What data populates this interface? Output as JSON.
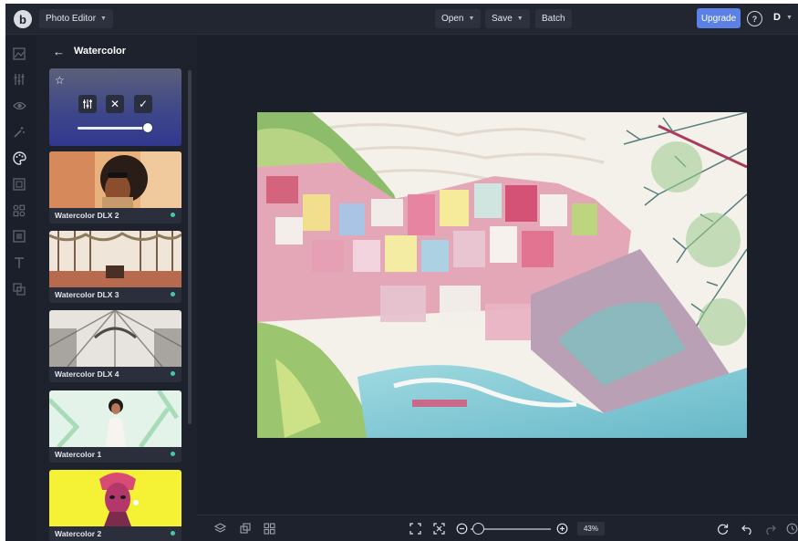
{
  "topbar": {
    "app_menu_label": "Photo Editor",
    "open_label": "Open",
    "save_label": "Save",
    "batch_label": "Batch",
    "upgrade_label": "Upgrade",
    "help_glyph": "?",
    "user_initial": "D",
    "logo_letter": "b"
  },
  "rail": {
    "icons": [
      "image-icon",
      "adjust-icon",
      "eye-icon",
      "magic-wand-icon",
      "palette-icon",
      "frame-icon",
      "graphics-icon",
      "texture-icon",
      "text-icon",
      "layers-icon"
    ],
    "active": "palette-icon"
  },
  "panel": {
    "title": "Watercolor",
    "settings": {
      "favorite_icon": "star-icon",
      "adjust_icon": "sliders-icon",
      "cancel_icon": "close-icon",
      "apply_icon": "check-icon",
      "intensity": 0.92
    },
    "effects": [
      {
        "label": "Watercolor DLX 2"
      },
      {
        "label": "Watercolor DLX 3"
      },
      {
        "label": "Watercolor DLX 4"
      },
      {
        "label": "Watercolor 1"
      },
      {
        "label": "Watercolor 2"
      }
    ]
  },
  "bottombar": {
    "zoom_label": "43%",
    "zoom_fraction": 0.05,
    "left_icons": [
      "layers-icon",
      "crop-icon",
      "grid-icon"
    ],
    "fit_icons": [
      "fit-screen-icon",
      "actual-size-icon"
    ],
    "right_icons": [
      "reset-icon",
      "undo-icon",
      "redo-icon",
      "history-icon"
    ]
  },
  "colors": {
    "accent": "#5b80e6",
    "active_dot": "#47c9a8",
    "background": "#1b1f29"
  }
}
